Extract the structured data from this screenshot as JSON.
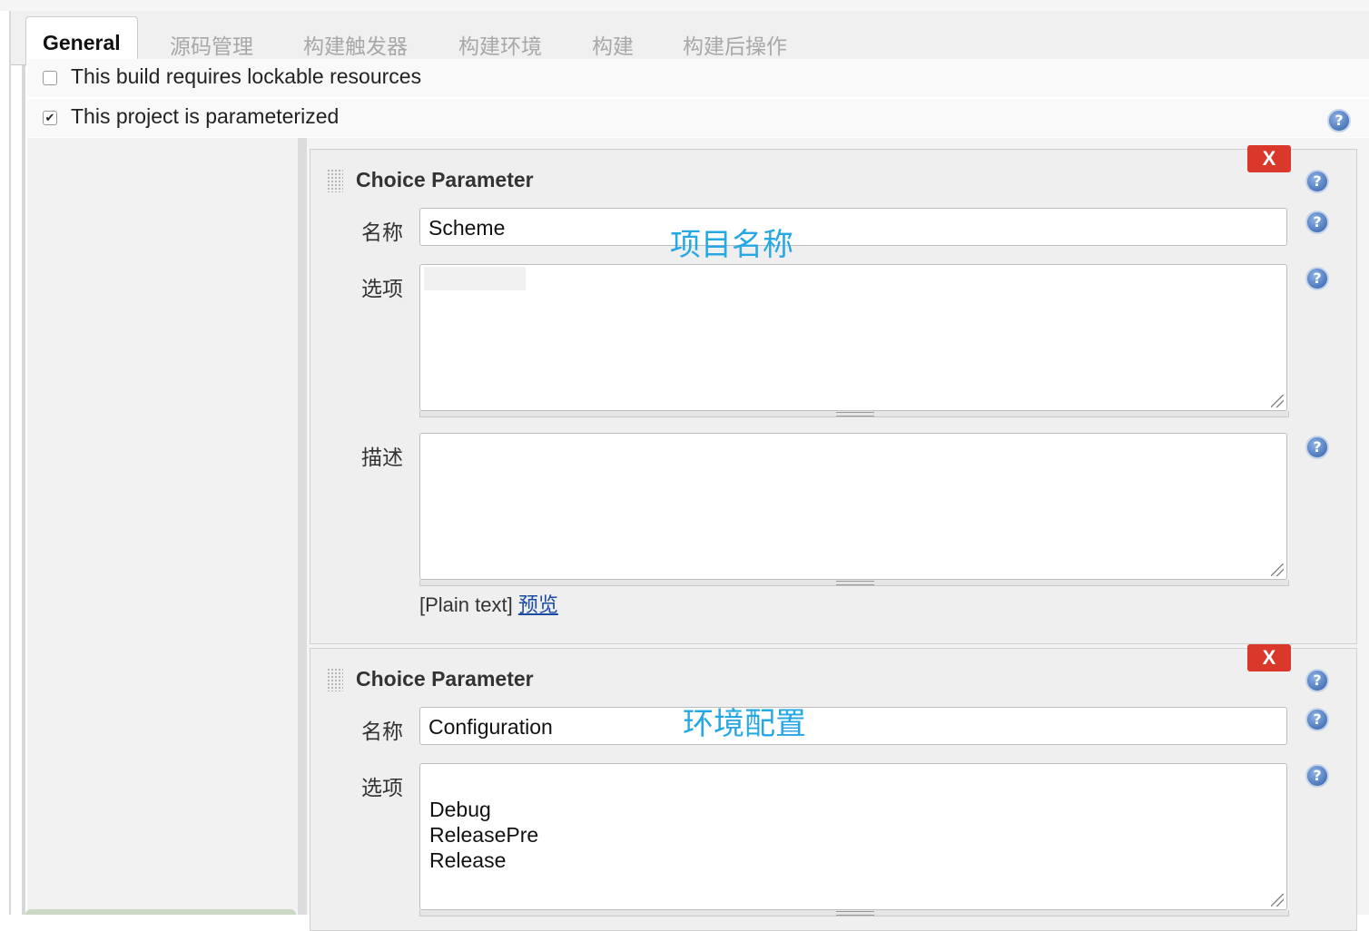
{
  "tabs": [
    {
      "label": "General",
      "active": true
    },
    {
      "label": "源码管理"
    },
    {
      "label": "构建触发器"
    },
    {
      "label": "构建环境"
    },
    {
      "label": "构建"
    },
    {
      "label": "构建后操作"
    }
  ],
  "options": {
    "lockable_resources": {
      "label": "This build requires lockable resources",
      "checked": false
    },
    "parameterized": {
      "label": "This project is parameterized",
      "checked": true
    }
  },
  "help_glyph": "?",
  "parameters": [
    {
      "title": "Choice Parameter",
      "delete_label": "X",
      "name_label": "名称",
      "name_value": "Scheme",
      "annotation": "项目名称",
      "choices_label": "选项",
      "choices_value": "",
      "description_label": "描述",
      "description_value": "",
      "format_label": "[Plain text]",
      "preview_link": "预览"
    },
    {
      "title": "Choice Parameter",
      "delete_label": "X",
      "name_label": "名称",
      "name_value": "Configuration",
      "annotation": "环境配置",
      "choices_label": "选项",
      "choices_value": "Debug\nReleasePre\nRelease"
    }
  ],
  "colors": {
    "annotation": "#26a8e4",
    "delete": "#d9382a",
    "help": "#2f5fa8"
  }
}
